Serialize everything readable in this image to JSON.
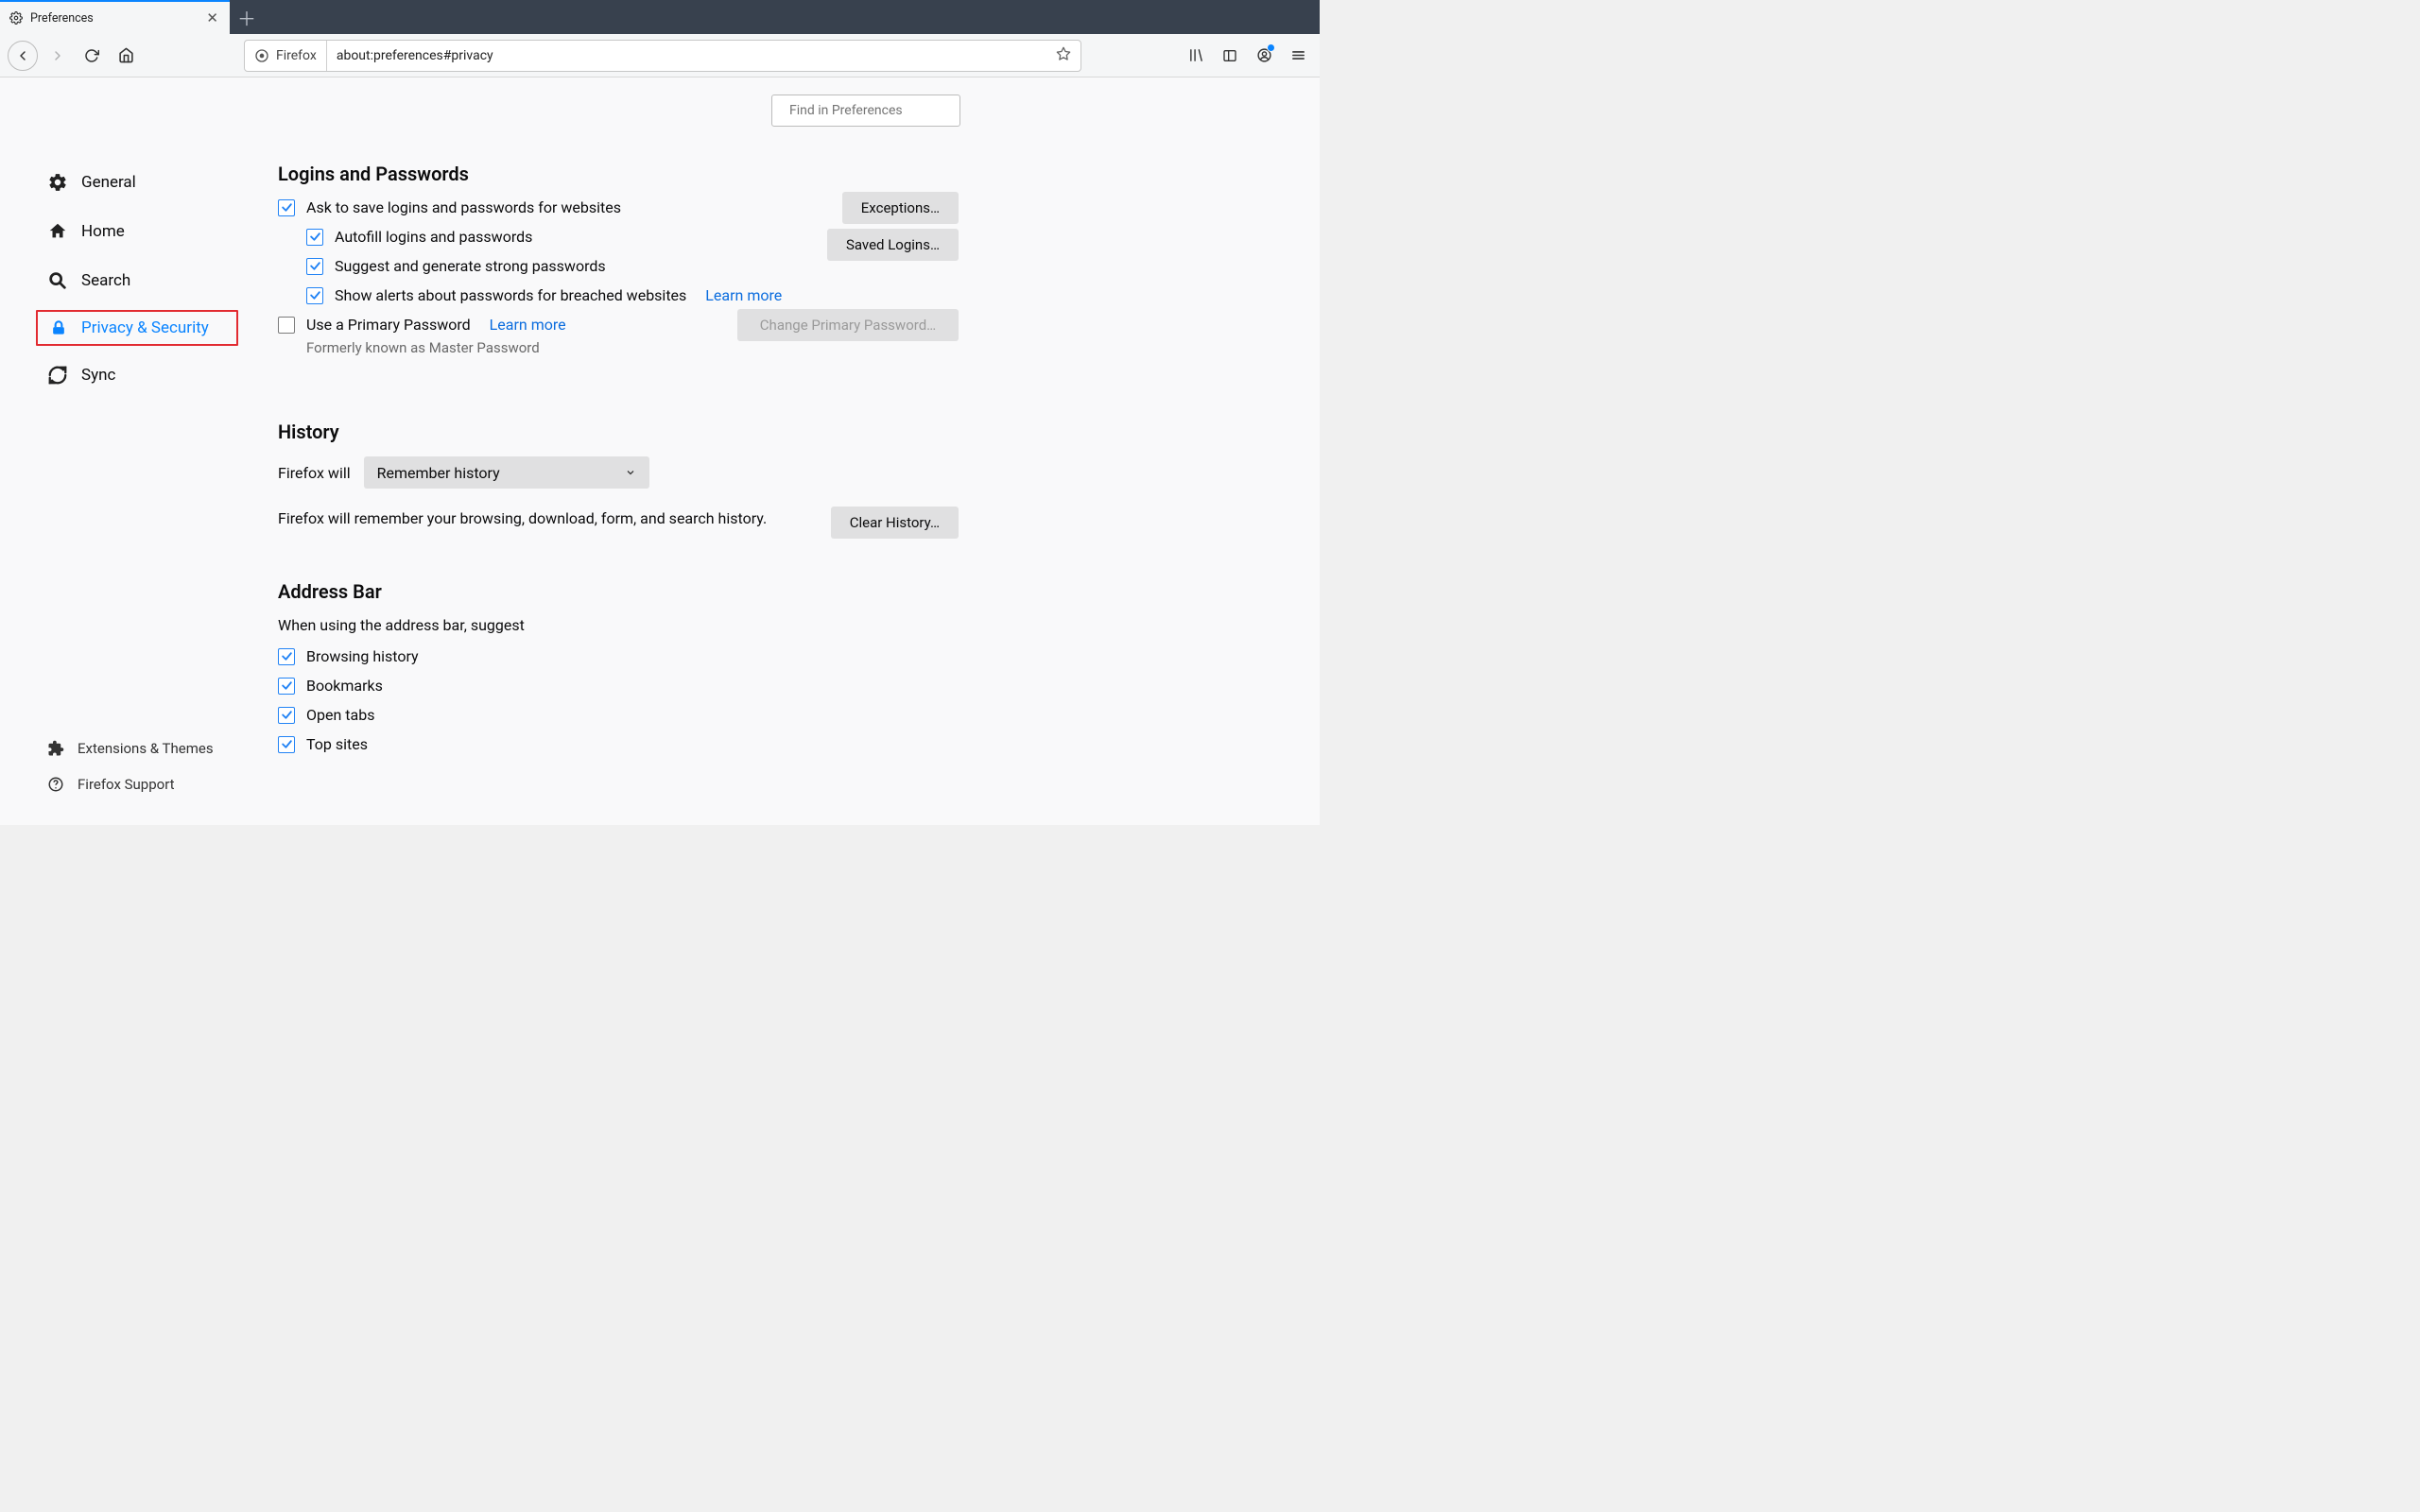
{
  "tab": {
    "title": "Preferences"
  },
  "urlbar": {
    "identity": "Firefox",
    "url": "about:preferences#privacy"
  },
  "sidebar": {
    "items": [
      {
        "label": "General"
      },
      {
        "label": "Home"
      },
      {
        "label": "Search"
      },
      {
        "label": "Privacy & Security"
      },
      {
        "label": "Sync"
      }
    ],
    "bottom": [
      {
        "label": "Extensions & Themes"
      },
      {
        "label": "Firefox Support"
      }
    ]
  },
  "search": {
    "placeholder": "Find in Preferences"
  },
  "logins": {
    "heading": "Logins and Passwords",
    "ask": "Ask to save logins and passwords for websites",
    "autofill": "Autofill logins and passwords",
    "suggest": "Suggest and generate strong passwords",
    "alerts": "Show alerts about passwords for breached websites",
    "alerts_learn": "Learn more",
    "primary": "Use a Primary Password",
    "primary_learn": "Learn more",
    "formerly": "Formerly known as Master Password",
    "btn_exceptions": "Exceptions…",
    "btn_saved": "Saved Logins…",
    "btn_change": "Change Primary Password…"
  },
  "history": {
    "heading": "History",
    "prefix": "Firefox will",
    "mode": "Remember history",
    "desc": "Firefox will remember your browsing, download, form, and search history.",
    "btn_clear": "Clear History…"
  },
  "addressbar": {
    "heading": "Address Bar",
    "intro": "When using the address bar, suggest",
    "items": [
      "Browsing history",
      "Bookmarks",
      "Open tabs",
      "Top sites"
    ]
  }
}
